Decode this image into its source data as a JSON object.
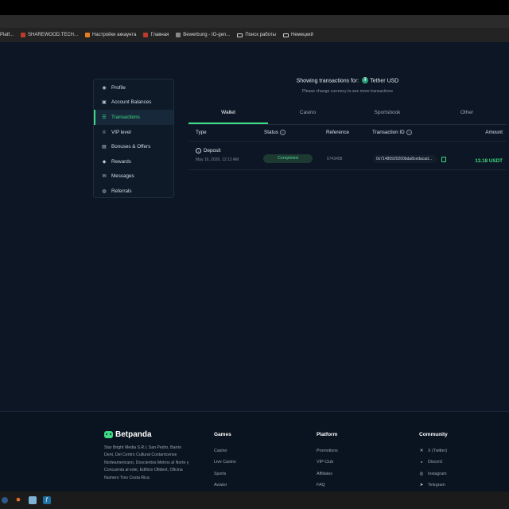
{
  "bookmarks": [
    {
      "label": "Platf...",
      "color": ""
    },
    {
      "label": "SHAREWOOD.TECH...",
      "color": "#c0392b"
    },
    {
      "label": "Настройки аккаунта",
      "color": "#e67e22"
    },
    {
      "label": "Главная",
      "color": "#c0392b"
    },
    {
      "label": "Bewerbung - IO-gen...",
      "color": "#888888"
    },
    {
      "label": "Поиск работы",
      "color": ""
    },
    {
      "label": "Немецкий",
      "color": ""
    }
  ],
  "sidebar": {
    "items": [
      {
        "label": "Profile",
        "icon": "user-circle-icon"
      },
      {
        "label": "Account Balances",
        "icon": "wallet-icon"
      },
      {
        "label": "Transactions",
        "icon": "list-icon"
      },
      {
        "label": "VIP level",
        "icon": "trophy-icon"
      },
      {
        "label": "Bonuses & Offers",
        "icon": "gift-icon"
      },
      {
        "label": "Rewards",
        "icon": "ticket-icon"
      },
      {
        "label": "Messages",
        "icon": "envelope-icon"
      },
      {
        "label": "Referrals",
        "icon": "people-icon"
      }
    ],
    "active_index": 2
  },
  "header": {
    "title_prefix": "Showing transactions for:",
    "currency": "Tether USD",
    "hint": "Please change currency to see more transactions"
  },
  "tabs": [
    {
      "label": "Wallet"
    },
    {
      "label": "Casino"
    },
    {
      "label": "Sportsbook"
    },
    {
      "label": "Other"
    }
  ],
  "active_tab": 0,
  "table": {
    "headers": {
      "type": "Type",
      "status": "Status",
      "reference": "Reference",
      "transaction_id": "Transaction ID",
      "amount": "Amount"
    },
    "rows": [
      {
        "type": "Deposit",
        "date": "May 16, 2026, 12:13 AM",
        "status": "Completed",
        "reference": "5743458",
        "transaction_id": "0x71485920200bda8cedacad...",
        "amount": "13.18 USDT"
      }
    ]
  },
  "footer": {
    "brand": "Betpanda",
    "address": "Star Bright Media S.R.L San Pedro, Barrio Dent, Del Centro Cultural Costarricense Norteamericano, Doscientos Metros al Norte y Concuenta al este, Edificio Ofident, Oficina Numero Tres Costa Rica",
    "columns": [
      {
        "title": "Games",
        "links": [
          "Casino",
          "Live Casino",
          "Sports",
          "Aviator"
        ]
      },
      {
        "title": "Platform",
        "links": [
          "Promotions",
          "VIP-Club",
          "Affiliates",
          "FAQ"
        ]
      },
      {
        "title": "Community",
        "links": [
          "X (Twitter)",
          "Discord",
          "Instagram",
          "Telegram"
        ]
      }
    ]
  },
  "colors": {
    "accent": "#3ddc84",
    "background": "#0c1624",
    "tether": "#26a17b"
  }
}
